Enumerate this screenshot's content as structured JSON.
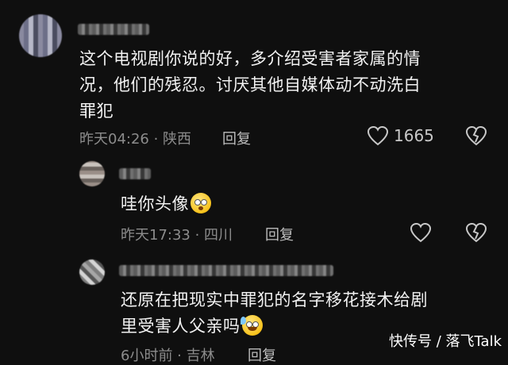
{
  "comments": [
    {
      "content": "这个电视剧你说的好，多介绍受害者家属的情况，他们的残忍。讨厌其他自媒体动不动洗白罪犯",
      "line1": "这个电视剧你说的好，多介绍受害者家属的情",
      "line2": "况，他们的残忍。讨厌其他自媒体动不动洗白",
      "line3": "罪犯",
      "meta": "昨天04:26 · 陕西",
      "reply_label": "回复",
      "like_count": "1665"
    },
    {
      "content": "哇你头像",
      "emoji": "astonished-emoji",
      "meta": "昨天17:33 · 四川",
      "reply_label": "回复"
    },
    {
      "content_line1": "还原在把现实中罪犯的名字移花接木给剧",
      "content_line2": "里受害人父亲吗",
      "emoji": "sweat-smile-emoji",
      "meta": "6小时前 · 吉林",
      "reply_label": "回复"
    }
  ],
  "watermark": "快传号 / 落飞Talk",
  "colors": {
    "background": "#0f0f0f",
    "text": "#f2f2f2",
    "meta": "#8c8c8c"
  }
}
